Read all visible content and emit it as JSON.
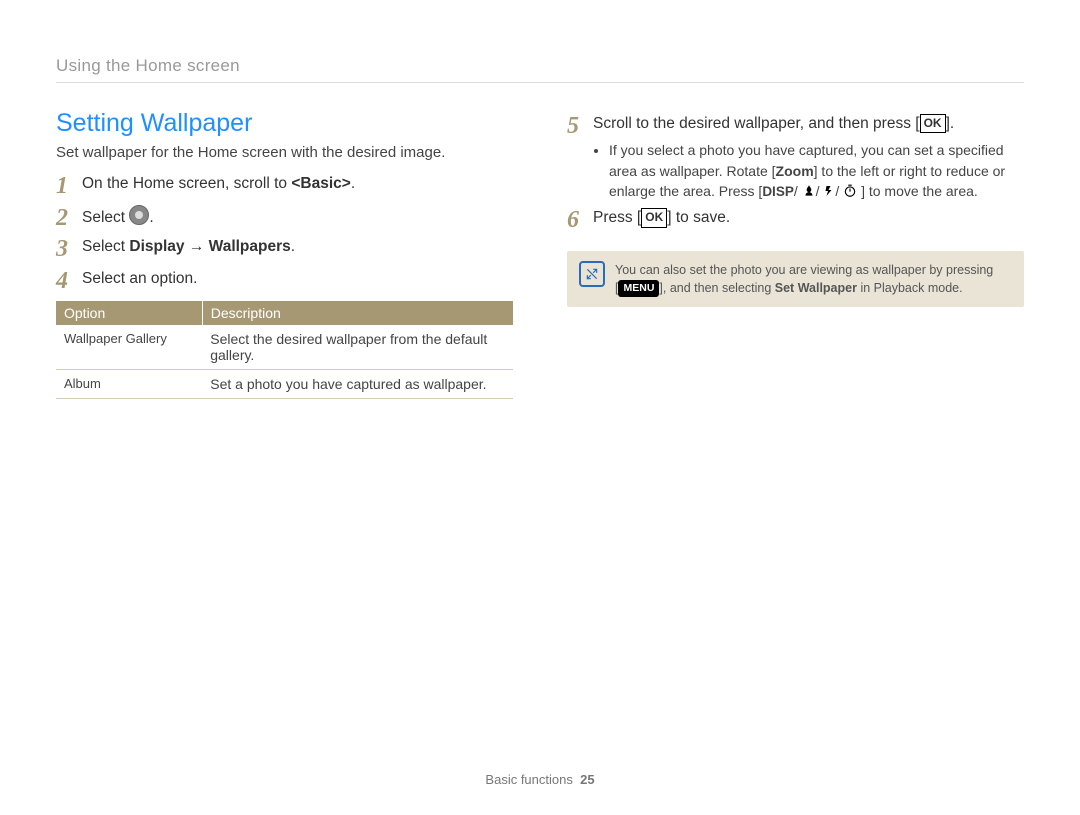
{
  "running_head": "Using the Home screen",
  "section_title": "Setting Wallpaper",
  "lead": "Set wallpaper for the Home screen with the desired image.",
  "steps": {
    "s1_pre": "On the Home screen, scroll to ",
    "s1_basic": "<Basic>",
    "s1_post": ".",
    "s2_pre": "Select ",
    "s2_post": ".",
    "s3_pre": "Select ",
    "s3_bold": "Display → Wallpapers",
    "s3_post": ".",
    "s4": "Select an option.",
    "s5_pre": "Scroll to the desired wallpaper, and then press [",
    "s5_ok": "OK",
    "s5_post": "].",
    "s5_bullet_pre": "If you select a photo you have captured, you can set a specified area as wallpaper. Rotate [",
    "s5_bullet_zoom": "Zoom",
    "s5_bullet_mid": "] to the left or right to reduce or enlarge the area. Press [",
    "s5_bullet_disp": "DISP",
    "s5_bullet_end": "] to move the area.",
    "s6_pre": "Press [",
    "s6_ok": "OK",
    "s6_post": "] to save."
  },
  "table": {
    "head_option": "Option",
    "head_desc": "Description",
    "rows": [
      {
        "opt": "Wallpaper Gallery",
        "desc": "Select the desired wallpaper from the default gallery."
      },
      {
        "opt": "Album",
        "desc": "Set a photo you have captured as wallpaper."
      }
    ]
  },
  "note": {
    "line1": "You can also set the photo you are viewing as wallpaper by pressing",
    "menu_label": "MENU",
    "line2_pre": "[",
    "line2_mid": "], and then selecting ",
    "line2_bold": "Set Wallpaper",
    "line2_post": " in Playback mode."
  },
  "footer": {
    "section": "Basic functions",
    "page": "25"
  }
}
